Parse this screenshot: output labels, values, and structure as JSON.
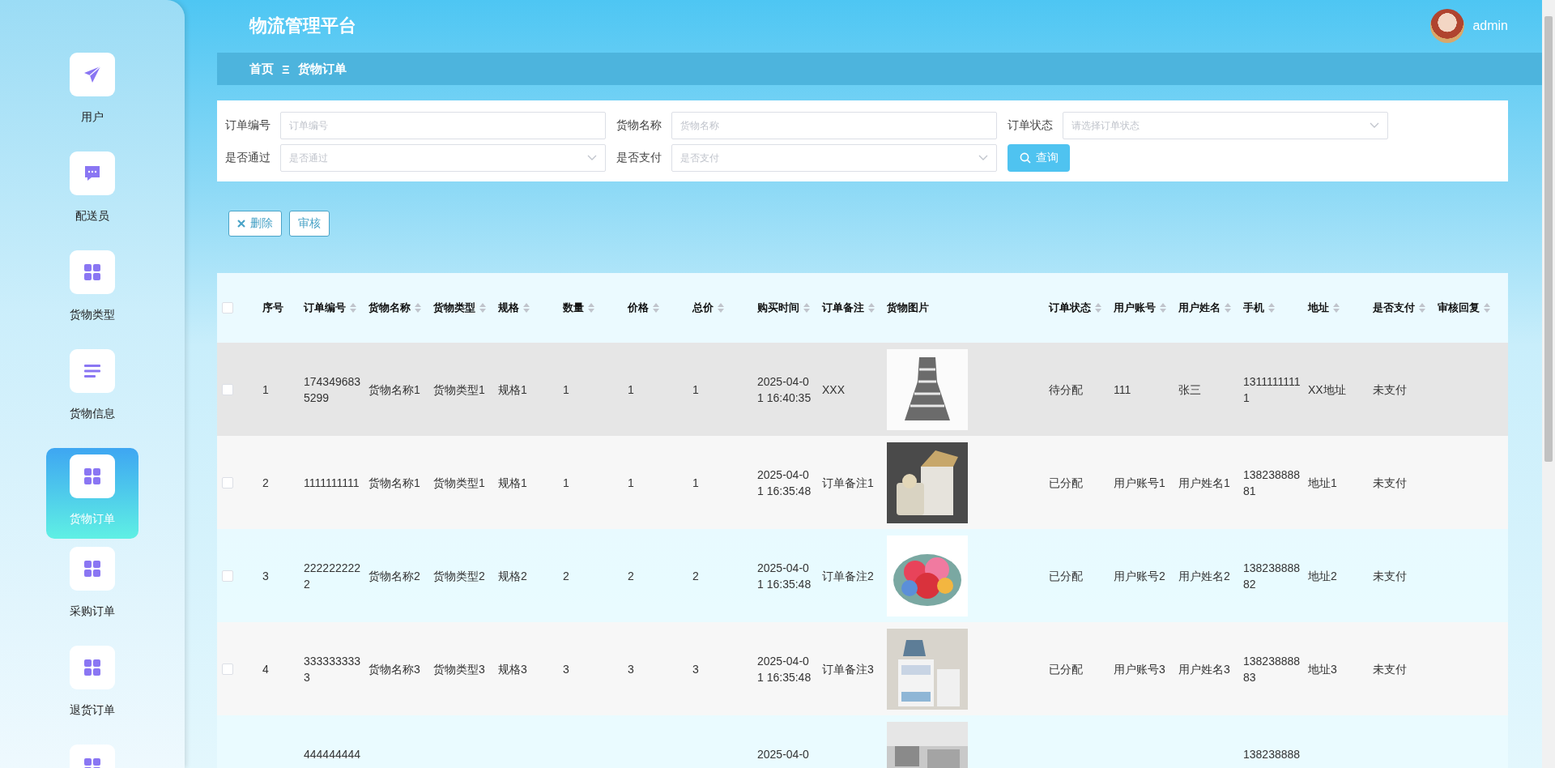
{
  "header": {
    "title": "物流管理平台",
    "user": "admin"
  },
  "sidebar": {
    "items": [
      {
        "label": "用户",
        "selected": false
      },
      {
        "label": "配送员",
        "selected": false
      },
      {
        "label": "货物类型",
        "selected": false
      },
      {
        "label": "货物信息",
        "selected": false
      },
      {
        "label": "货物订单",
        "selected": true
      },
      {
        "label": "采购订单",
        "selected": false
      },
      {
        "label": "退货订单",
        "selected": false
      },
      {
        "selected": false
      }
    ]
  },
  "breadcrumb": {
    "items": [
      "首页",
      "货物订单"
    ],
    "separator": "Ξ"
  },
  "search": {
    "fields": [
      {
        "label": "订单编号",
        "kind": "input",
        "placeholder": "订单编号"
      },
      {
        "label": "货物名称",
        "kind": "input",
        "placeholder": "货物名称"
      },
      {
        "label": "订单状态",
        "kind": "select",
        "placeholder": "请选择订单状态"
      },
      {
        "label": "是否通过",
        "kind": "select",
        "placeholder": "是否通过"
      },
      {
        "label": "是否支付",
        "kind": "select",
        "placeholder": "是否支付"
      }
    ],
    "button": "查询"
  },
  "actions": [
    {
      "label": "删除",
      "kind": "delete"
    },
    {
      "label": "审核",
      "kind": "plain"
    }
  ],
  "table": {
    "select_all": {
      "checked": false
    },
    "columns": [
      {
        "label": "序号",
        "sortable": false
      },
      {
        "label": "订单编号",
        "sortable": true
      },
      {
        "label": "货物名称",
        "sortable": true
      },
      {
        "label": "货物类型",
        "sortable": true
      },
      {
        "label": "规格",
        "sortable": true
      },
      {
        "label": "数量",
        "sortable": true
      },
      {
        "label": "价格",
        "sortable": true
      },
      {
        "label": "总价",
        "sortable": true
      },
      {
        "label": "购买时间",
        "sortable": true
      },
      {
        "label": "订单备注",
        "sortable": true
      },
      {
        "label": "货物图片",
        "sortable": false
      },
      {
        "label": "订单状态",
        "sortable": true
      },
      {
        "label": "用户账号",
        "sortable": true
      },
      {
        "label": "用户姓名",
        "sortable": true
      },
      {
        "label": "手机",
        "sortable": true
      },
      {
        "label": "地址",
        "sortable": true
      },
      {
        "label": "是否支付",
        "sortable": true
      },
      {
        "label": "审核回复",
        "sortable": true
      }
    ],
    "rows": [
      {
        "checked": false,
        "hovered": true,
        "cells": [
          "1",
          "1743496835299",
          "货物名称1",
          "货物类型1",
          "规格1",
          "1",
          "1",
          "1",
          "2025-04-01 16:40:35",
          "XXX",
          {
            "kind": "picture"
          },
          "待分配",
          "111",
          "张三",
          "13111111111",
          "XX地址",
          "未支付"
        ]
      },
      {
        "checked": false,
        "hovered": false,
        "cells": [
          "2",
          "1111111111",
          "货物名称1",
          "货物类型1",
          "规格1",
          "1",
          "1",
          "1",
          "2025-04-01 16:35:48",
          "订单备注1",
          {
            "kind": "picture"
          },
          "已分配",
          "用户账号1",
          "用户姓名1",
          "13823888881",
          "地址1",
          "未支付"
        ]
      },
      {
        "checked": false,
        "hovered": false,
        "cells": [
          "3",
          "2222222222",
          "货物名称2",
          "货物类型2",
          "规格2",
          "2",
          "2",
          "2",
          "2025-04-01 16:35:48",
          "订单备注2",
          {
            "kind": "picture"
          },
          "已分配",
          "用户账号2",
          "用户姓名2",
          "13823888882",
          "地址2",
          "未支付"
        ]
      },
      {
        "checked": false,
        "hovered": false,
        "cells": [
          "4",
          "3333333333",
          "货物名称3",
          "货物类型3",
          "规格3",
          "3",
          "3",
          "3",
          "2025-04-01 16:35:48",
          "订单备注3",
          {
            "kind": "picture"
          },
          "已分配",
          "用户账号3",
          "用户姓名3",
          "13823888883",
          "地址3",
          "未支付"
        ]
      },
      {
        "hovered": false,
        "cells": [
          null,
          "444444444",
          null,
          null,
          null,
          null,
          null,
          null,
          "2025-04-0",
          null,
          {
            "kind": "picture"
          },
          null,
          null,
          null,
          "138238888",
          null,
          null
        ]
      }
    ]
  }
}
